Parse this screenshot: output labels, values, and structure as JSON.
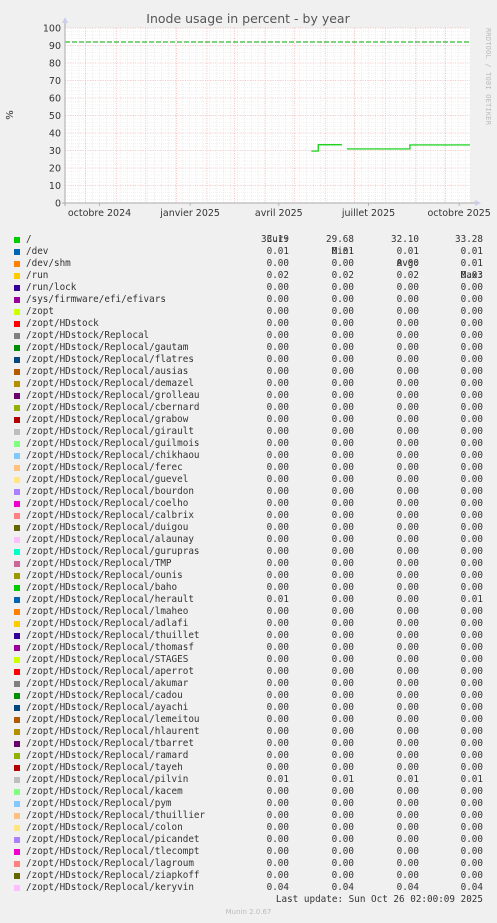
{
  "chart_data": {
    "type": "line",
    "title": "Inode usage in percent - by year",
    "ylabel": "%",
    "ylim": [
      0,
      100
    ],
    "yticks": [
      0,
      10,
      20,
      30,
      40,
      50,
      60,
      70,
      80,
      90,
      100
    ],
    "xlim": [
      "2024-09-10",
      "2025-10-26"
    ],
    "xticks": [
      {
        "date": "2024-10-15",
        "label": "octobre 2024"
      },
      {
        "date": "2025-01-15",
        "label": "janvier 2025"
      },
      {
        "date": "2025-04-15",
        "label": "avril 2025"
      },
      {
        "date": "2025-07-15",
        "label": "juillet 2025"
      },
      {
        "date": "2025-10-15",
        "label": "octobre 2025"
      }
    ],
    "warning_line": {
      "value": 92,
      "color": "#00aa00"
    },
    "grid": true,
    "series": [
      {
        "name": "/",
        "color": "#00cc00",
        "segments": [
          [
            [
              "2025-05-18",
              29.68
            ],
            [
              "2025-05-25",
              29.68
            ],
            [
              "2025-05-25",
              33.28
            ],
            [
              "2025-06-18",
              33.28
            ]
          ],
          [
            [
              "2025-06-23",
              30.9
            ],
            [
              "2025-08-26",
              30.9
            ],
            [
              "2025-08-26",
              33.19
            ],
            [
              "2025-10-26",
              33.19
            ]
          ]
        ]
      }
    ]
  },
  "legend": {
    "headers": {
      "cur": "Cur:",
      "min": "Min:",
      "avg": "Avg:",
      "max": "Max:"
    },
    "rows": [
      {
        "name": "/",
        "color": "#00cc00",
        "cur": "33.19",
        "min": "29.68",
        "avg": "32.10",
        "max": "33.28"
      },
      {
        "name": "/dev",
        "color": "#0066b3",
        "cur": "0.01",
        "min": "0.01",
        "avg": "0.01",
        "max": "0.01"
      },
      {
        "name": "/dev/shm",
        "color": "#ff8000",
        "cur": "0.00",
        "min": "0.00",
        "avg": "0.00",
        "max": "0.01"
      },
      {
        "name": "/run",
        "color": "#ffcc00",
        "cur": "0.02",
        "min": "0.02",
        "avg": "0.02",
        "max": "0.03"
      },
      {
        "name": "/run/lock",
        "color": "#330099",
        "cur": "0.00",
        "min": "0.00",
        "avg": "0.00",
        "max": "0.00"
      },
      {
        "name": "/sys/firmware/efi/efivars",
        "color": "#990099",
        "cur": "0.00",
        "min": "0.00",
        "avg": "0.00",
        "max": "0.00"
      },
      {
        "name": "/zopt",
        "color": "#ccff00",
        "cur": "0.00",
        "min": "0.00",
        "avg": "0.00",
        "max": "0.00"
      },
      {
        "name": "/zopt/HDstock",
        "color": "#ff0000",
        "cur": "0.00",
        "min": "0.00",
        "avg": "0.00",
        "max": "0.00"
      },
      {
        "name": "/zopt/HDstock/Replocal",
        "color": "#808080",
        "cur": "0.00",
        "min": "0.00",
        "avg": "0.00",
        "max": "0.00"
      },
      {
        "name": "/zopt/HDstock/Replocal/gautam",
        "color": "#008f00",
        "cur": "0.00",
        "min": "0.00",
        "avg": "0.00",
        "max": "0.00"
      },
      {
        "name": "/zopt/HDstock/Replocal/flatres",
        "color": "#00487d",
        "cur": "0.00",
        "min": "0.00",
        "avg": "0.00",
        "max": "0.00"
      },
      {
        "name": "/zopt/HDstock/Replocal/ausias",
        "color": "#b35a00",
        "cur": "0.00",
        "min": "0.00",
        "avg": "0.00",
        "max": "0.00"
      },
      {
        "name": "/zopt/HDstock/Replocal/demazel",
        "color": "#b38f00",
        "cur": "0.00",
        "min": "0.00",
        "avg": "0.00",
        "max": "0.00"
      },
      {
        "name": "/zopt/HDstock/Replocal/grolleau",
        "color": "#6b006b",
        "cur": "0.00",
        "min": "0.00",
        "avg": "0.00",
        "max": "0.00"
      },
      {
        "name": "/zopt/HDstock/Replocal/cbernard",
        "color": "#8fb300",
        "cur": "0.00",
        "min": "0.00",
        "avg": "0.00",
        "max": "0.00"
      },
      {
        "name": "/zopt/HDstock/Replocal/grabow",
        "color": "#b30000",
        "cur": "0.00",
        "min": "0.00",
        "avg": "0.00",
        "max": "0.00"
      },
      {
        "name": "/zopt/HDstock/Replocal/girault",
        "color": "#bebebe",
        "cur": "0.00",
        "min": "0.00",
        "avg": "0.00",
        "max": "0.00"
      },
      {
        "name": "/zopt/HDstock/Replocal/guilmois",
        "color": "#80ff80",
        "cur": "0.00",
        "min": "0.00",
        "avg": "0.00",
        "max": "0.00"
      },
      {
        "name": "/zopt/HDstock/Replocal/chikhaou",
        "color": "#80c9ff",
        "cur": "0.00",
        "min": "0.00",
        "avg": "0.00",
        "max": "0.00"
      },
      {
        "name": "/zopt/HDstock/Replocal/ferec",
        "color": "#ffc080",
        "cur": "0.00",
        "min": "0.00",
        "avg": "0.00",
        "max": "0.00"
      },
      {
        "name": "/zopt/HDstock/Replocal/guevel",
        "color": "#ffe680",
        "cur": "0.00",
        "min": "0.00",
        "avg": "0.00",
        "max": "0.00"
      },
      {
        "name": "/zopt/HDstock/Replocal/bourdon",
        "color": "#aa80ff",
        "cur": "0.00",
        "min": "0.00",
        "avg": "0.00",
        "max": "0.00"
      },
      {
        "name": "/zopt/HDstock/Replocal/coelho",
        "color": "#ee00cc",
        "cur": "0.00",
        "min": "0.00",
        "avg": "0.00",
        "max": "0.00"
      },
      {
        "name": "/zopt/HDstock/Replocal/calbrix",
        "color": "#ff8080",
        "cur": "0.00",
        "min": "0.00",
        "avg": "0.00",
        "max": "0.00"
      },
      {
        "name": "/zopt/HDstock/Replocal/duigou",
        "color": "#666600",
        "cur": "0.00",
        "min": "0.00",
        "avg": "0.00",
        "max": "0.00"
      },
      {
        "name": "/zopt/HDstock/Replocal/alaunay",
        "color": "#ffbfff",
        "cur": "0.00",
        "min": "0.00",
        "avg": "0.00",
        "max": "0.00"
      },
      {
        "name": "/zopt/HDstock/Replocal/gurupras",
        "color": "#00ffcc",
        "cur": "0.00",
        "min": "0.00",
        "avg": "0.00",
        "max": "0.00"
      },
      {
        "name": "/zopt/HDstock/Replocal/TMP",
        "color": "#cc6699",
        "cur": "0.00",
        "min": "0.00",
        "avg": "0.00",
        "max": "0.00"
      },
      {
        "name": "/zopt/HDstock/Replocal/ounis",
        "color": "#999900",
        "cur": "0.00",
        "min": "0.00",
        "avg": "0.00",
        "max": "0.00"
      },
      {
        "name": "/zopt/HDstock/Replocal/baho",
        "color": "#00cc00",
        "cur": "0.00",
        "min": "0.00",
        "avg": "0.00",
        "max": "0.00"
      },
      {
        "name": "/zopt/HDstock/Replocal/herault",
        "color": "#0066b3",
        "cur": "0.01",
        "min": "0.00",
        "avg": "0.00",
        "max": "0.01"
      },
      {
        "name": "/zopt/HDstock/Replocal/lmaheo",
        "color": "#ff8000",
        "cur": "0.00",
        "min": "0.00",
        "avg": "0.00",
        "max": "0.00"
      },
      {
        "name": "/zopt/HDstock/Replocal/adlafi",
        "color": "#ffcc00",
        "cur": "0.00",
        "min": "0.00",
        "avg": "0.00",
        "max": "0.00"
      },
      {
        "name": "/zopt/HDstock/Replocal/thuillet",
        "color": "#330099",
        "cur": "0.00",
        "min": "0.00",
        "avg": "0.00",
        "max": "0.00"
      },
      {
        "name": "/zopt/HDstock/Replocal/thomasf",
        "color": "#990099",
        "cur": "0.00",
        "min": "0.00",
        "avg": "0.00",
        "max": "0.00"
      },
      {
        "name": "/zopt/HDstock/Replocal/STAGES",
        "color": "#ccff00",
        "cur": "0.00",
        "min": "0.00",
        "avg": "0.00",
        "max": "0.00"
      },
      {
        "name": "/zopt/HDstock/Replocal/aperrot",
        "color": "#ff0000",
        "cur": "0.00",
        "min": "0.00",
        "avg": "0.00",
        "max": "0.00"
      },
      {
        "name": "/zopt/HDstock/Replocal/akumar",
        "color": "#808080",
        "cur": "0.00",
        "min": "0.00",
        "avg": "0.00",
        "max": "0.00"
      },
      {
        "name": "/zopt/HDstock/Replocal/cadou",
        "color": "#008f00",
        "cur": "0.00",
        "min": "0.00",
        "avg": "0.00",
        "max": "0.00"
      },
      {
        "name": "/zopt/HDstock/Replocal/ayachi",
        "color": "#00487d",
        "cur": "0.00",
        "min": "0.00",
        "avg": "0.00",
        "max": "0.00"
      },
      {
        "name": "/zopt/HDstock/Replocal/lemeitou",
        "color": "#b35a00",
        "cur": "0.00",
        "min": "0.00",
        "avg": "0.00",
        "max": "0.00"
      },
      {
        "name": "/zopt/HDstock/Replocal/hlaurent",
        "color": "#b38f00",
        "cur": "0.00",
        "min": "0.00",
        "avg": "0.00",
        "max": "0.00"
      },
      {
        "name": "/zopt/HDstock/Replocal/tbarret",
        "color": "#6b006b",
        "cur": "0.00",
        "min": "0.00",
        "avg": "0.00",
        "max": "0.00"
      },
      {
        "name": "/zopt/HDstock/Replocal/ramard",
        "color": "#8fb300",
        "cur": "0.00",
        "min": "0.00",
        "avg": "0.00",
        "max": "0.00"
      },
      {
        "name": "/zopt/HDstock/Replocal/tayeh",
        "color": "#b30000",
        "cur": "0.00",
        "min": "0.00",
        "avg": "0.00",
        "max": "0.00"
      },
      {
        "name": "/zopt/HDstock/Replocal/pilvin",
        "color": "#bebebe",
        "cur": "0.01",
        "min": "0.01",
        "avg": "0.01",
        "max": "0.01"
      },
      {
        "name": "/zopt/HDstock/Replocal/kacem",
        "color": "#80ff80",
        "cur": "0.00",
        "min": "0.00",
        "avg": "0.00",
        "max": "0.00"
      },
      {
        "name": "/zopt/HDstock/Replocal/pym",
        "color": "#80c9ff",
        "cur": "0.00",
        "min": "0.00",
        "avg": "0.00",
        "max": "0.00"
      },
      {
        "name": "/zopt/HDstock/Replocal/thuillier",
        "color": "#ffc080",
        "cur": "0.00",
        "min": "0.00",
        "avg": "0.00",
        "max": "0.00"
      },
      {
        "name": "/zopt/HDstock/Replocal/colon",
        "color": "#ffe680",
        "cur": "0.00",
        "min": "0.00",
        "avg": "0.00",
        "max": "0.00"
      },
      {
        "name": "/zopt/HDstock/Replocal/picandet",
        "color": "#aa80ff",
        "cur": "0.00",
        "min": "0.00",
        "avg": "0.00",
        "max": "0.00"
      },
      {
        "name": "/zopt/HDstock/Replocal/tlecompt",
        "color": "#ee00cc",
        "cur": "0.00",
        "min": "0.00",
        "avg": "0.00",
        "max": "0.00"
      },
      {
        "name": "/zopt/HDstock/Replocal/lagroum",
        "color": "#ff8080",
        "cur": "0.00",
        "min": "0.00",
        "avg": "0.00",
        "max": "0.00"
      },
      {
        "name": "/zopt/HDstock/Replocal/ziapkoff",
        "color": "#666600",
        "cur": "0.00",
        "min": "0.00",
        "avg": "0.00",
        "max": "0.00"
      },
      {
        "name": "/zopt/HDstock/Replocal/keryvin",
        "color": "#ffbfff",
        "cur": "0.04",
        "min": "0.04",
        "avg": "0.04",
        "max": "0.04"
      }
    ]
  },
  "footer": {
    "last_update": "Last update: Sun Oct 26 02:00:09 2025",
    "generator": "Munin 2.0.67",
    "watermark": "RRDTOOL / TOBI OETIKER"
  }
}
